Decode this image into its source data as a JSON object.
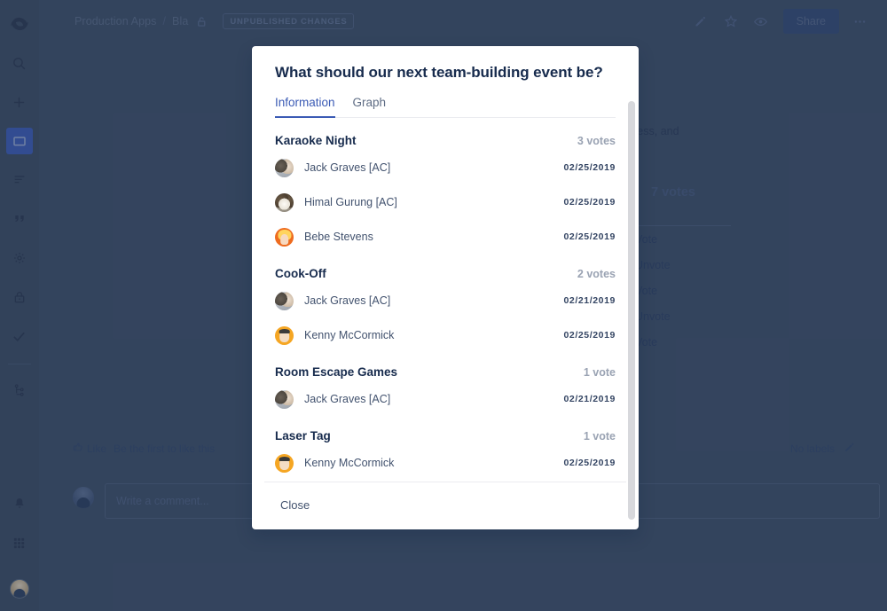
{
  "sidebar": {
    "items": [
      {
        "name": "logo-icon",
        "label": "Confluence"
      },
      {
        "name": "search-icon",
        "label": "Search"
      },
      {
        "name": "create-icon",
        "label": "Create"
      },
      {
        "name": "space-home-icon",
        "label": "Space home"
      },
      {
        "name": "pages-icon",
        "label": "Pages"
      },
      {
        "name": "blog-icon",
        "label": "Blog"
      },
      {
        "name": "gear-icon",
        "label": "Space settings"
      },
      {
        "name": "lock-icon",
        "label": "Restricted"
      },
      {
        "name": "check-icon",
        "label": "Tasks"
      },
      {
        "name": "page-tree-icon",
        "label": "Page tree"
      }
    ],
    "bottom": [
      {
        "name": "notifications-icon",
        "label": "Notifications"
      },
      {
        "name": "app-switcher-icon",
        "label": "App switcher"
      },
      {
        "name": "avatar",
        "label": "Your profile"
      }
    ]
  },
  "topbar": {
    "breadcrumbs": [
      {
        "label": "Production Apps"
      },
      {
        "label": "Bla"
      }
    ],
    "separator": "/",
    "lock_icon": "lock-icon",
    "badge": "UNPUBLISHED CHANGES",
    "actions": [
      {
        "name": "edit-icon",
        "label": "Edit"
      },
      {
        "name": "star-icon",
        "label": "Star"
      },
      {
        "name": "watch-icon",
        "label": "Watch"
      }
    ],
    "share_label": "Share",
    "more_label": "•••"
  },
  "background": {
    "text_fragment": "e stress, and",
    "total_votes": "7 votes",
    "vote_links": [
      "Vote",
      "Unvote",
      "Vote",
      "Unvote",
      "Vote"
    ],
    "like_label": "Like",
    "like_sub": "Be the first to like this",
    "no_labels": "No labels",
    "comment_placeholder": "Write a comment..."
  },
  "modal": {
    "title": "What should our next team-building event be?",
    "tabs": [
      {
        "label": "Information",
        "active": true
      },
      {
        "label": "Graph",
        "active": false
      }
    ],
    "close_label": "Close",
    "options": [
      {
        "name": "Karaoke Night",
        "votes_label": "3 votes",
        "voters": [
          {
            "name": "Jack Graves [AC]",
            "date": "02/25/2019",
            "avatar": "av-jack"
          },
          {
            "name": "Himal Gurung [AC]",
            "date": "02/25/2019",
            "avatar": "av-himal"
          },
          {
            "name": "Bebe Stevens",
            "date": "02/25/2019",
            "avatar": "av-bebe"
          }
        ]
      },
      {
        "name": "Cook-Off",
        "votes_label": "2 votes",
        "voters": [
          {
            "name": "Jack Graves [AC]",
            "date": "02/21/2019",
            "avatar": "av-jack"
          },
          {
            "name": "Kenny McCormick",
            "date": "02/25/2019",
            "avatar": "av-kenny"
          }
        ]
      },
      {
        "name": "Room Escape Games",
        "votes_label": "1 vote",
        "voters": [
          {
            "name": "Jack Graves [AC]",
            "date": "02/21/2019",
            "avatar": "av-jack"
          }
        ]
      },
      {
        "name": "Laser Tag",
        "votes_label": "1 vote",
        "voters": [
          {
            "name": "Kenny McCormick",
            "date": "02/25/2019",
            "avatar": "av-kenny"
          }
        ]
      }
    ]
  },
  "colors": {
    "accent": "#3b5bb5",
    "app_background": "#3d4f6b",
    "modal_background": "#ffffff",
    "heading": "#172b4d",
    "muted": "#9aa3b3"
  }
}
